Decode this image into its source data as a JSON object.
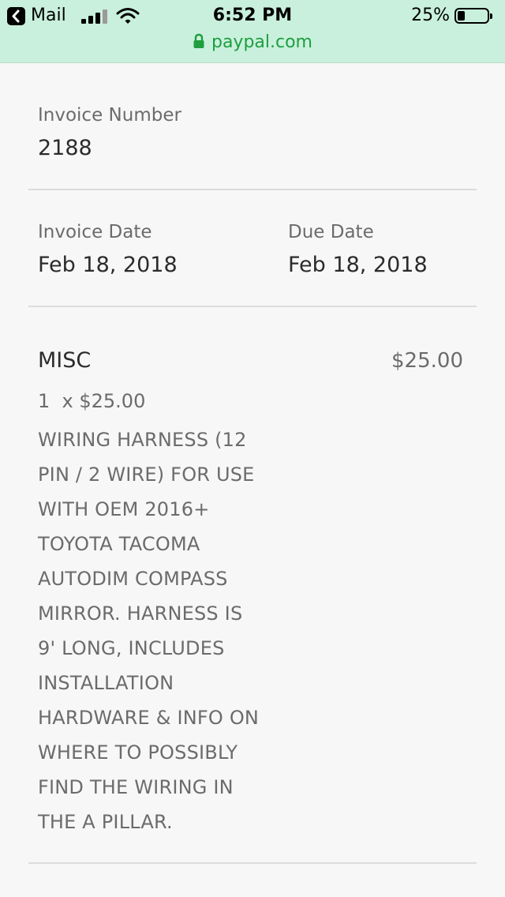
{
  "status_bar": {
    "back_app": "Mail",
    "time": "6:52 PM",
    "battery_percent": "25%",
    "battery_level": 0.25,
    "signal_bars": 3,
    "signal_bars_total": 4
  },
  "url_bar": {
    "domain": "paypal.com",
    "secure": true,
    "color": "#1f9e3f"
  },
  "invoice": {
    "number_label": "Invoice Number",
    "number": "2188",
    "date_label": "Invoice Date",
    "date": "Feb 18, 2018",
    "due_label": "Due Date",
    "due": "Feb 18, 2018"
  },
  "line_item": {
    "name": "MISC",
    "amount": "$25.00",
    "quantity_line": "1  x $25.00",
    "description": "WIRING HARNESS (12\nPIN / 2 WIRE) FOR USE\nWITH OEM 2016+\nTOYOTA TACOMA\nAUTODIM COMPASS\nMIRROR.  HARNESS IS\n9' LONG, INCLUDES\nINSTALLATION\nHARDWARE & INFO ON\nWHERE TO POSSIBLY\nFIND THE WIRING IN\nTHE A PILLAR."
  },
  "icons": {
    "back": "chevron-left-icon",
    "signal": "cellular-signal-icon",
    "wifi": "wifi-icon",
    "battery": "battery-icon",
    "lock": "lock-icon"
  }
}
